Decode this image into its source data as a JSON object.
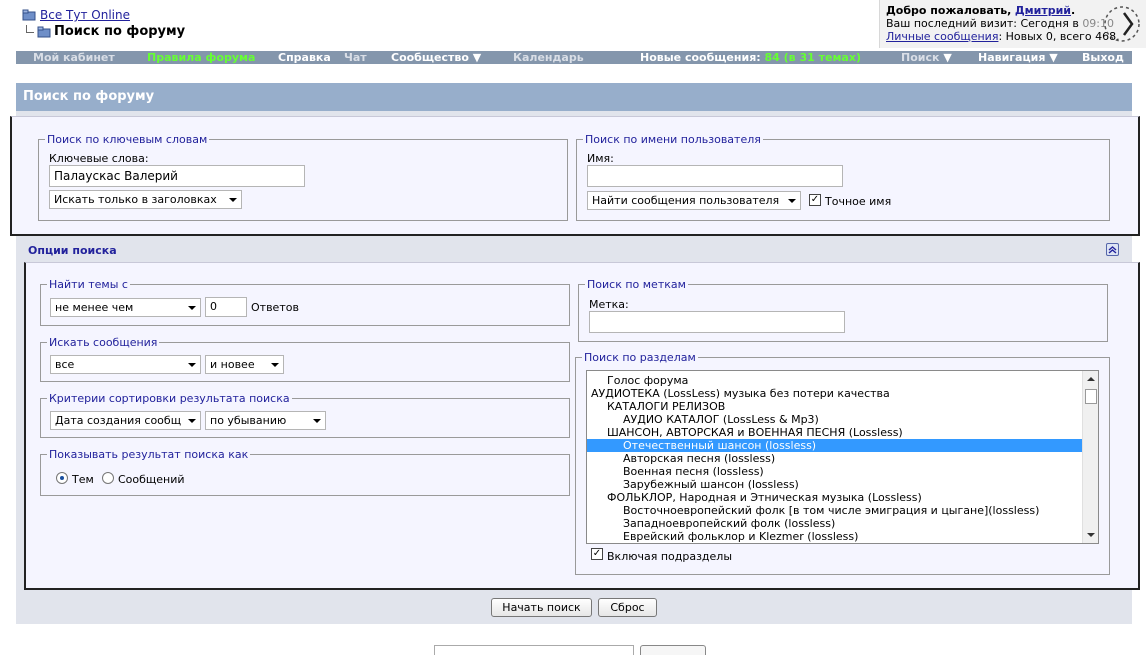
{
  "header": {
    "breadcrumb_root": "Все Тут Online",
    "page_title": "Поиск по форуму"
  },
  "welcome": {
    "greeting": "Добро пожаловать,",
    "user": "Дмитрий",
    "user_suffix": ".",
    "last_visit_label": "Ваш последний визит: Сегодня в",
    "last_visit_time": "09:10",
    "pm_link": "Личные сообщения",
    "pm_text": ": Новых 0, всего 468."
  },
  "nav": {
    "my_cabinet": "Мой кабинет",
    "rules": "Правила форума",
    "help": "Справка",
    "chat": "Чат",
    "community": "Сообщество",
    "calendar": "Календарь",
    "new_messages_label": "Новые сообщения:",
    "new_messages_count": "84 (в 31 темах)",
    "search": "Поиск",
    "navigation": "Навигация",
    "logout": "Выход"
  },
  "panel_title": "Поиск по форуму",
  "keyword_search": {
    "legend": "Поиск по ключевым словам",
    "label": "Ключевые слова:",
    "value": "Палаускас Валерий",
    "scope_select": "Искать только в заголовках"
  },
  "user_search": {
    "legend": "Поиск по имени пользователя",
    "label": "Имя:",
    "value": "",
    "mode_select": "Найти сообщения пользователя",
    "exact_label": "Точное имя",
    "exact_checked": true
  },
  "options_title": "Опции поиска",
  "find_topics": {
    "legend": "Найти темы с",
    "compare_select": "не менее чем",
    "count": "0",
    "unit": "Ответов"
  },
  "search_messages": {
    "legend": "Искать сообщения",
    "period_select": "все",
    "direction_select": "и новее"
  },
  "sort": {
    "legend": "Критерии сортировки результата поиска",
    "field_select": "Дата создания сообщ",
    "order_select": "по убыванию"
  },
  "show_as": {
    "legend": "Показывать результат поиска как",
    "option_topics": "Тем",
    "option_posts": "Сообщений",
    "selected": "topics"
  },
  "tag_search": {
    "legend": "Поиск по меткам",
    "label": "Метка:",
    "value": ""
  },
  "section_search": {
    "legend": "Поиск по разделам",
    "items": [
      {
        "label": "Голос форума",
        "level": 1,
        "selected": false
      },
      {
        "label": "АУДИОТЕКА (LossLess) музыка без потери качества",
        "level": 0,
        "selected": false
      },
      {
        "label": "КАТАЛОГИ РЕЛИЗОВ",
        "level": 1,
        "selected": false
      },
      {
        "label": "АУДИО КАТАЛОГ (LossLess & Mp3)",
        "level": 2,
        "selected": false
      },
      {
        "label": "ШАНСОН, АВТОРСКАЯ и ВОЕННАЯ ПЕСНЯ (Lossless)",
        "level": 1,
        "selected": false
      },
      {
        "label": "Отечественный шансон (lossless)",
        "level": 2,
        "selected": true
      },
      {
        "label": "Авторская песня (lossless)",
        "level": 2,
        "selected": false
      },
      {
        "label": "Военная песня (lossless)",
        "level": 2,
        "selected": false
      },
      {
        "label": "Зарубежный шансон (lossless)",
        "level": 2,
        "selected": false
      },
      {
        "label": "ФОЛЬКЛОР, Народная и Этническая музыка (Lossless)",
        "level": 1,
        "selected": false
      },
      {
        "label": "Восточноевропейский фолк [в том числе эмиграция и цыгане](lossless)",
        "level": 2,
        "selected": false
      },
      {
        "label": "Западноевропейский фолк (lossless)",
        "level": 2,
        "selected": false
      },
      {
        "label": "Еврейский фольклор и Klezmer (lossless)",
        "level": 2,
        "selected": false
      }
    ],
    "include_sub_label": "Включая подразделы",
    "include_sub_checked": true
  },
  "buttons": {
    "start": "Начать поиск",
    "reset": "Сброс"
  },
  "colors": {
    "nav_bg": "#8496ac",
    "panel_head_bg": "#97aecb",
    "link": "#22229c",
    "selected_item": "#3399ff",
    "nav_highlight": "#66ff33"
  }
}
